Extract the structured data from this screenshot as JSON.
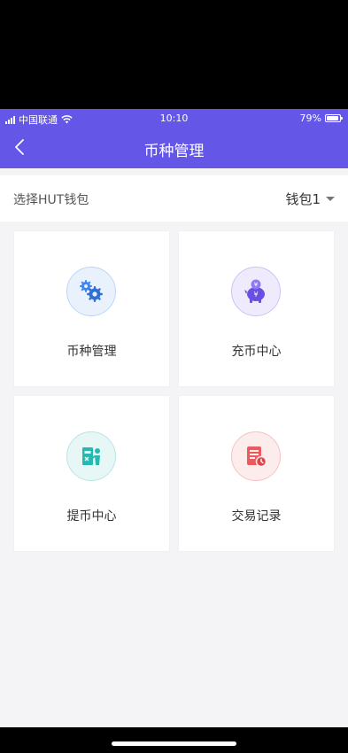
{
  "status_bar": {
    "carrier": "中国联通",
    "time": "10:10",
    "battery_percent": "79%",
    "battery_level": 0.79
  },
  "nav": {
    "title": "币种管理"
  },
  "wallet_selector": {
    "label": "选择HUT钱包",
    "value": "钱包1"
  },
  "tiles": [
    {
      "label": "币种管理",
      "icon": "gears-icon",
      "color": "#3e86f0"
    },
    {
      "label": "充币中心",
      "icon": "piggy-bank-yuan-icon",
      "color": "#6a4fe0"
    },
    {
      "label": "提币中心",
      "icon": "withdraw-person-icon",
      "color": "#27b8b0"
    },
    {
      "label": "交易记录",
      "icon": "transaction-record-icon",
      "color": "#ea5a5e"
    }
  ],
  "colors": {
    "header": "#6456e6",
    "background": "#f4f4f6"
  }
}
